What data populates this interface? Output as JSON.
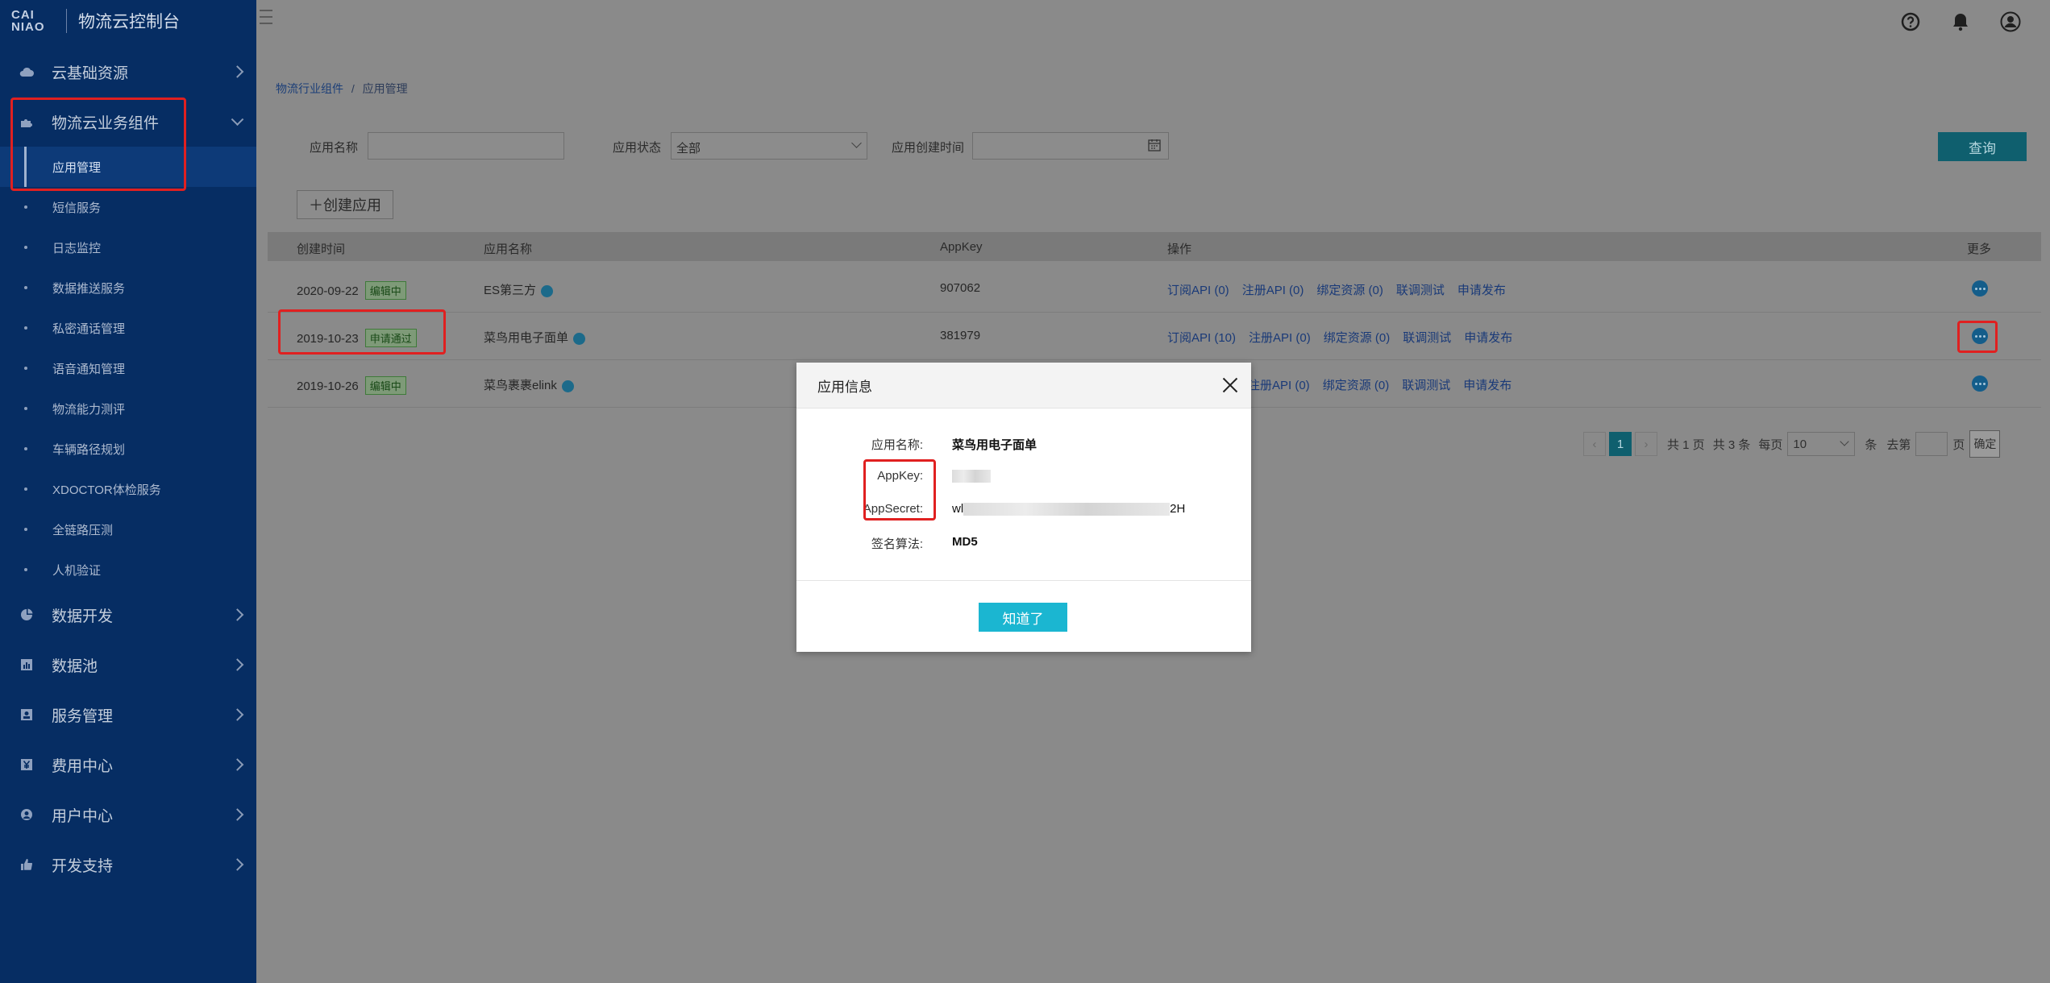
{
  "sidebar": {
    "logo_text": "CAI NIAO",
    "title": "物流云控制台",
    "groups": [
      {
        "label": "云基础资源",
        "icon": "cloud-icon"
      },
      {
        "label": "物流云业务组件",
        "icon": "puzzle-icon"
      }
    ],
    "sub_items": [
      {
        "label": "应用管理"
      },
      {
        "label": "短信服务"
      },
      {
        "label": "日志监控"
      },
      {
        "label": "数据推送服务"
      },
      {
        "label": "私密通话管理"
      },
      {
        "label": "语音通知管理"
      },
      {
        "label": "物流能力测评"
      },
      {
        "label": "车辆路径规划"
      },
      {
        "label": "XDOCTOR体检服务"
      },
      {
        "label": "全链路压测"
      },
      {
        "label": "人机验证"
      }
    ],
    "bottom_groups": [
      {
        "label": "数据开发",
        "icon": "pie-chart-icon"
      },
      {
        "label": "数据池",
        "icon": "bar-chart-icon"
      },
      {
        "label": "服务管理",
        "icon": "id-card-icon"
      },
      {
        "label": "费用中心",
        "icon": "yen-icon"
      },
      {
        "label": "用户中心",
        "icon": "user-icon"
      },
      {
        "label": "开发支持",
        "icon": "thumbs-up-icon"
      }
    ]
  },
  "breadcrumb": {
    "parent": "物流行业组件",
    "separator": "/",
    "current": "应用管理"
  },
  "filters": {
    "app_name_label": "应用名称",
    "app_name_value": "",
    "status_label": "应用状态",
    "status_value": "全部",
    "created_label": "应用创建时间",
    "created_value": "",
    "query_label": "查询"
  },
  "create_button": "＋创建应用",
  "table": {
    "headers": {
      "created": "创建时间",
      "name": "应用名称",
      "appkey": "AppKey",
      "ops": "操作",
      "more": "更多"
    },
    "rows": [
      {
        "created": "2020-09-22",
        "tag": "编辑中",
        "name": "ES第三方",
        "appkey": "907062",
        "ops": [
          "订阅API (0)",
          "注册API (0)",
          "绑定资源 (0)",
          "联调测试",
          "申请发布"
        ]
      },
      {
        "created": "2019-10-23",
        "tag": "申请通过",
        "name": "菜鸟用电子面单",
        "appkey": "381979",
        "ops": [
          "订阅API (10)",
          "注册API (0)",
          "绑定资源 (0)",
          "联调测试",
          "申请发布"
        ]
      },
      {
        "created": "2019-10-26",
        "tag": "编辑中",
        "name": "菜鸟裹裹elink",
        "appkey": "",
        "ops": [
          "注册API (0)",
          "绑定资源 (0)",
          "联调测试",
          "申请发布"
        ]
      }
    ]
  },
  "pager": {
    "current_page": "1",
    "total_pages_text": "共 1 页",
    "total_items_text": "共 3 条",
    "per_page_label": "每页",
    "per_page_value": "10",
    "per_page_unit": "条",
    "goto_label": "去第",
    "page_unit": "页",
    "confirm": "确定"
  },
  "modal": {
    "title": "应用信息",
    "fields": {
      "name_key": "应用名称:",
      "name_value": "菜鸟用电子面单",
      "appkey_key": "AppKey:",
      "secret_key": "AppSecret:",
      "secret_prefix": "wl",
      "secret_suffix": "2H",
      "sign_key": "签名算法:",
      "sign_value": "MD5"
    },
    "ok_label": "知道了"
  },
  "colors": {
    "sidebar_bg": "#062d63",
    "accent": "#1bb6d1",
    "annotation_red": "#e02020"
  }
}
